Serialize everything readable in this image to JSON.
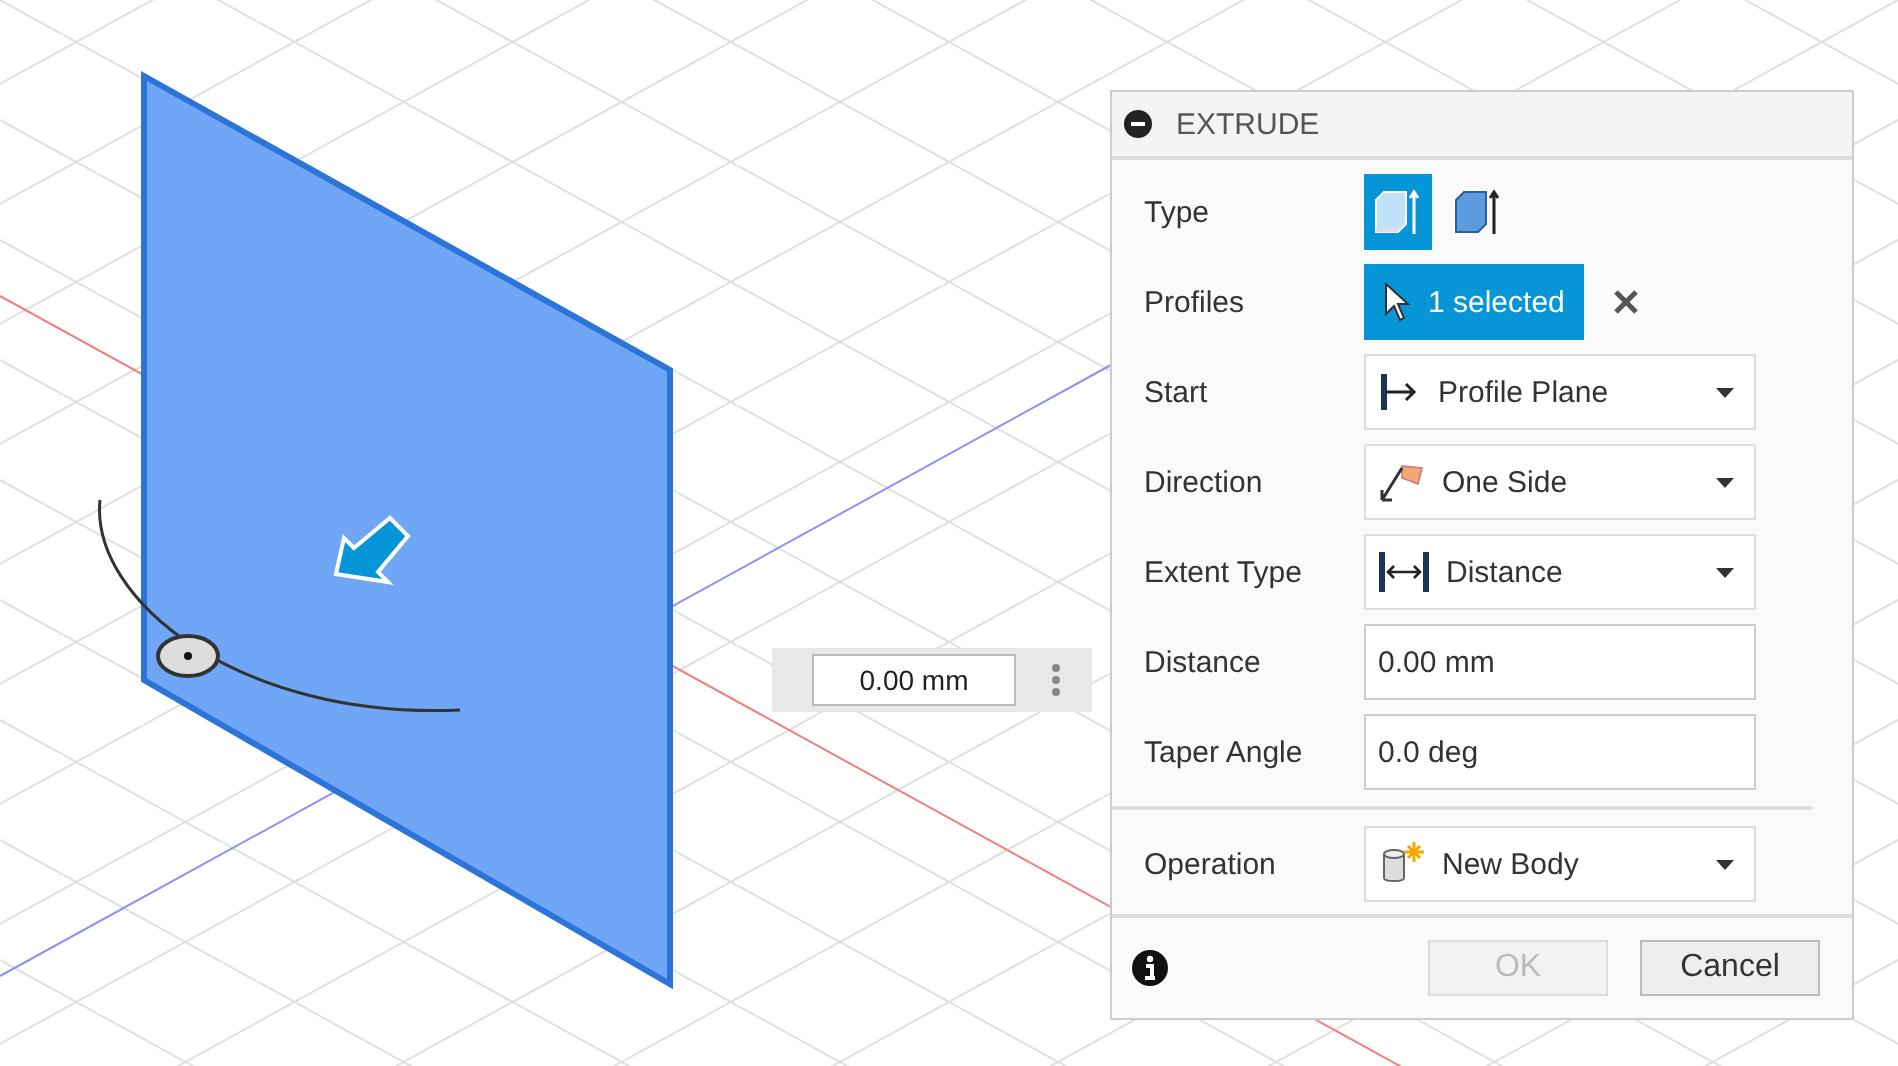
{
  "viewport": {
    "distance_input": {
      "value": "0.00 mm"
    }
  },
  "dialog": {
    "title": "EXTRUDE",
    "rows": [
      {
        "kind": "type",
        "label": "Type",
        "options": [
          {
            "selected": true
          },
          {
            "selected": false
          }
        ]
      },
      {
        "kind": "selection",
        "label": "Profiles",
        "value": "1 selected"
      },
      {
        "kind": "dropdown",
        "label": "Start",
        "value": "Profile Plane"
      },
      {
        "kind": "dropdown",
        "label": "Direction",
        "value": "One Side"
      },
      {
        "kind": "dropdown",
        "label": "Extent Type",
        "value": "Distance"
      },
      {
        "kind": "field",
        "label": "Distance",
        "value": "0.00 mm"
      },
      {
        "kind": "field",
        "label": "Taper Angle",
        "value": "0.0 deg"
      }
    ],
    "operation": {
      "kind": "dropdown",
      "label": "Operation",
      "value": "New Body"
    },
    "buttons": [
      {
        "label": "OK",
        "disabled": true
      },
      {
        "label": "Cancel",
        "disabled": false
      }
    ]
  }
}
